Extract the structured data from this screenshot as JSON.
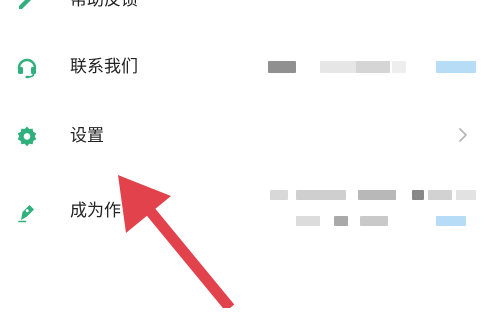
{
  "menu": {
    "items": [
      {
        "label": "帮助反馈",
        "icon": "edit-icon",
        "obscured_value": true
      },
      {
        "label": "联系我们",
        "icon": "headset-icon",
        "obscured_value": true
      },
      {
        "label": "设置",
        "icon": "gear-icon",
        "chevron": "chevron-right-icon"
      },
      {
        "label": "成为作",
        "icon": "pen-nib-icon",
        "obscured_value": true
      }
    ]
  },
  "annotation": {
    "type": "arrow",
    "color": "#e2424b",
    "points_to": "settings"
  },
  "colors": {
    "icon_green": "#2fb07d",
    "text": "#222222",
    "chevron": "#b7b7b7",
    "blurred_gray": "#d7d7d7",
    "blurred_blue": "#b6dcf7"
  }
}
